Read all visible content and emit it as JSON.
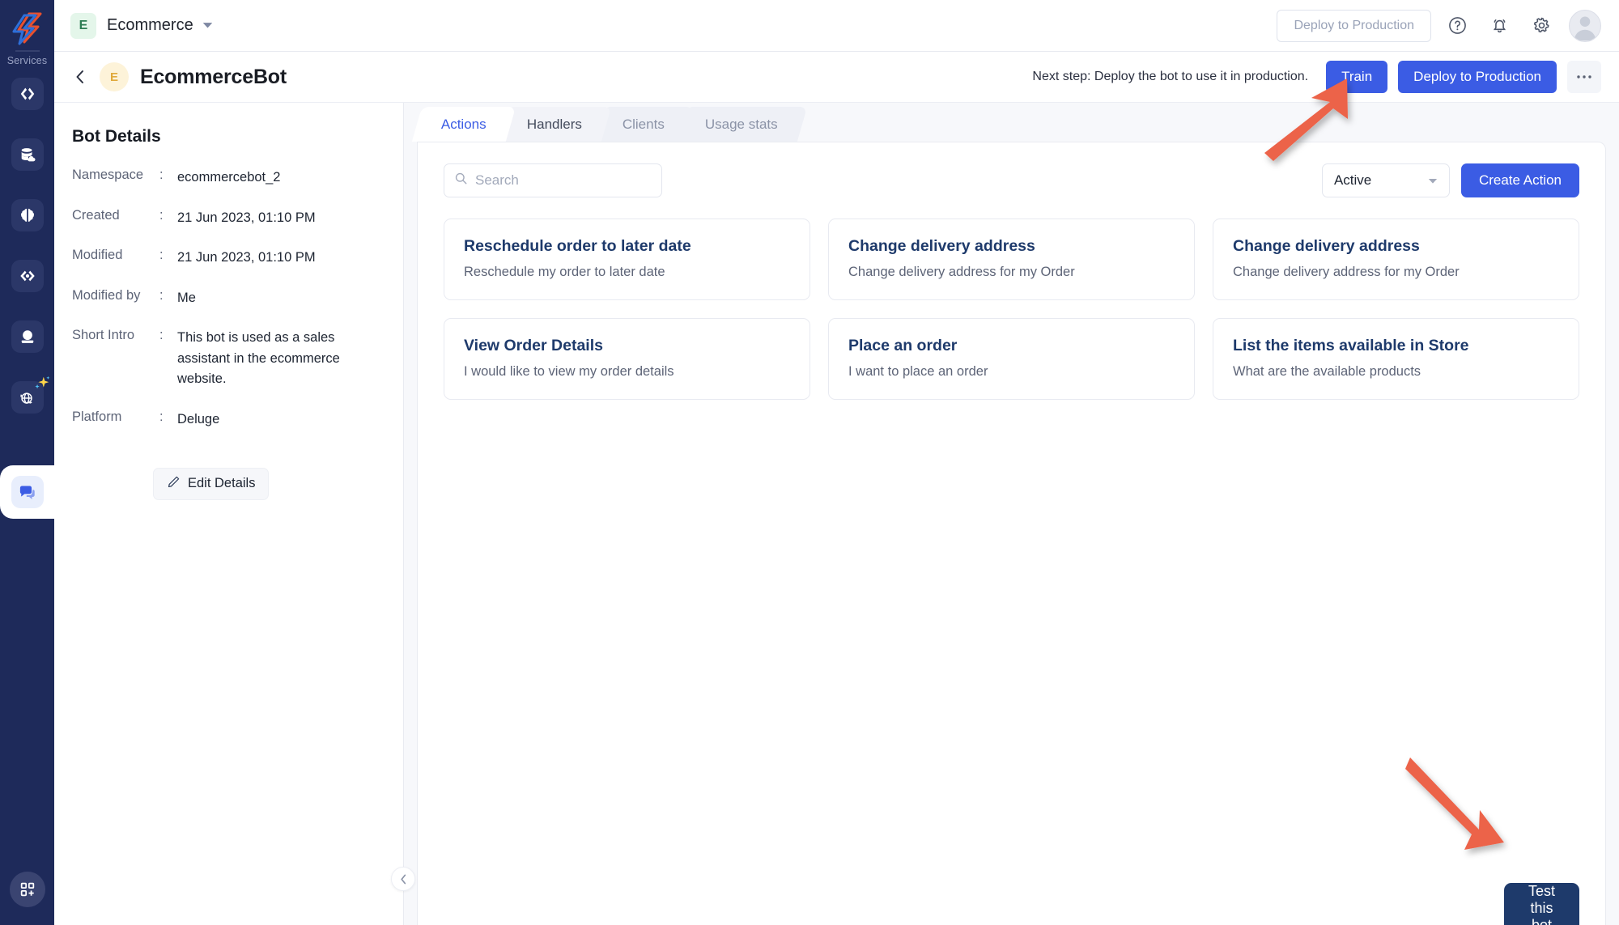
{
  "rail": {
    "logo_name": "zoho-logo",
    "services_label": "Services",
    "items": [
      {
        "name": "code-icon"
      },
      {
        "name": "database-cloud-icon"
      },
      {
        "name": "brain-icon"
      },
      {
        "name": "infinity-code-icon"
      },
      {
        "name": "crystal-ball-icon"
      },
      {
        "name": "globe-ai-icon"
      },
      {
        "name": "chat-bot-icon"
      }
    ],
    "bottom_item": {
      "name": "add-app-grid-icon"
    }
  },
  "topbar": {
    "org_initial": "E",
    "org_name": "Ecommerce",
    "deploy_label": "Deploy to Production",
    "help_icon": "help-circle-icon",
    "bell_icon": "notification-bell-icon",
    "settings_icon": "gear-icon",
    "avatar_name": "user-avatar"
  },
  "subheader": {
    "back_icon": "chevron-left-icon",
    "bot_initial": "E",
    "bot_title": "EcommerceBot",
    "next_step": "Next step: Deploy the bot to use it in production.",
    "train_label": "Train",
    "deploy_label": "Deploy to Production",
    "more_label": "•••"
  },
  "details": {
    "heading": "Bot Details",
    "colon": ":",
    "rows": [
      {
        "label": "Namespace",
        "value": "ecommercebot_2"
      },
      {
        "label": "Created",
        "value": "21 Jun 2023, 01:10 PM"
      },
      {
        "label": "Modified",
        "value": "21 Jun 2023, 01:10 PM"
      },
      {
        "label": "Modified by",
        "value": "Me"
      },
      {
        "label": "Short Intro",
        "value": "This bot is used as a sales assistant in the ecommerce website."
      },
      {
        "label": "Platform",
        "value": "Deluge"
      }
    ],
    "edit_label": "Edit Details",
    "edit_icon": "pencil-icon",
    "collapse_icon": "chevron-left-icon"
  },
  "tabs": [
    {
      "label": "Actions",
      "active": true
    },
    {
      "label": "Handlers",
      "active": false
    },
    {
      "label": "Clients",
      "active": false
    },
    {
      "label": "Usage stats",
      "active": false
    }
  ],
  "toolbar": {
    "search_placeholder": "Search",
    "search_value": "",
    "search_icon": "search-icon",
    "filter_value": "Active",
    "filter_icon": "chevron-down-icon",
    "create_label": "Create Action"
  },
  "actions": [
    {
      "title": "Reschedule order to later date",
      "desc": "Reschedule my order to later date"
    },
    {
      "title": "Change delivery address",
      "desc": "Change delivery address for my Order"
    },
    {
      "title": "Change delivery address",
      "desc": "Change delivery address for my Order"
    },
    {
      "title": "View Order Details",
      "desc": "I would like to view my order details"
    },
    {
      "title": "Place an order",
      "desc": "I want to place an order"
    },
    {
      "title": "List the items available in Store",
      "desc": "What are the available products"
    }
  ],
  "footer": {
    "test_bot_label": "Test this bot"
  },
  "annotations": {
    "arrow_color": "#ec6349",
    "arrow_train_target": "Train",
    "arrow_test_target": "Test this bot"
  },
  "colors": {
    "primary_blue": "#3b5ce4",
    "rail_navy": "#1e2a5a",
    "card_title_navy": "#1e3a6b",
    "arrow_red": "#ec6349"
  }
}
